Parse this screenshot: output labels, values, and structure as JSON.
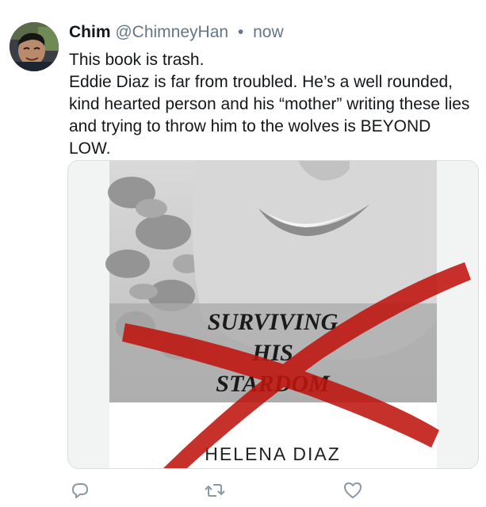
{
  "tweet": {
    "display_name": "Chim",
    "handle": "@ChimneyHan",
    "separator": "•",
    "timestamp": "now",
    "lines": [
      "This book is trash.",
      "Eddie Diaz is far from troubled. He’s a well rounded, kind hearted person and his “mother” writing these lies and trying to throw him to the wolves is BEYOND LOW."
    ]
  },
  "book_cover": {
    "title_lines": [
      "SURVIVING",
      "HIS",
      "STARDOM"
    ],
    "author": "HELENA DIAZ",
    "cross_color": "#c0150e"
  },
  "actions": {
    "reply_icon": "reply-icon",
    "retweet_icon": "retweet-icon",
    "like_icon": "heart-icon",
    "icon_color": "#8899a6"
  }
}
